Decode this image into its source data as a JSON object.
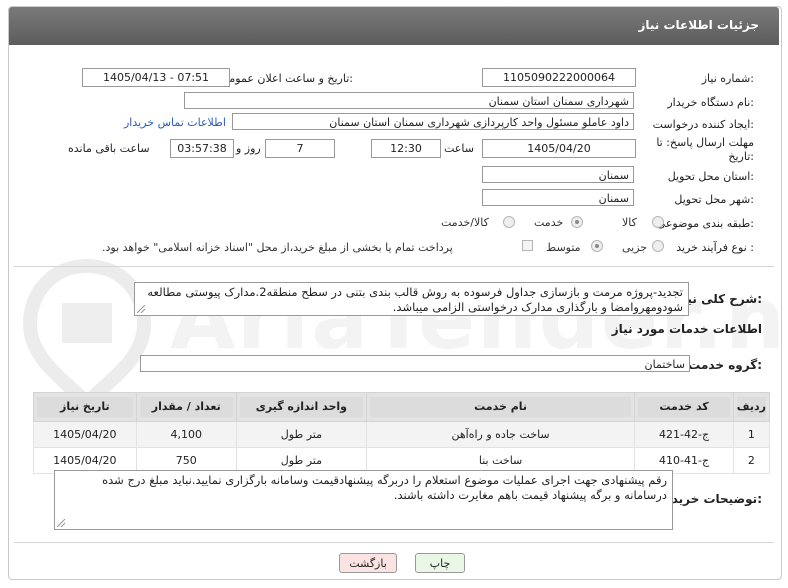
{
  "header": {
    "title": "جزئیات اطلاعات نیاز"
  },
  "watermark": {
    "text": "AriaTender.neT"
  },
  "form": {
    "need_number": {
      "label": "شماره نیاز:",
      "value": "1105090222000064"
    },
    "announce_datetime": {
      "label": "تاریخ و ساعت اعلان عمومی:",
      "value": "1405/04/13 - 07:51"
    },
    "buyer_org": {
      "label": "نام دستگاه خریدار:",
      "value": "شهرداری سمنان استان سمنان"
    },
    "requester": {
      "label": "ایجاد کننده درخواست:",
      "value": "داود عاملو مسئول واحد کارپردازی شهرداری سمنان استان سمنان",
      "contact_link": "اطلاعات تماس خریدار"
    },
    "deadline": {
      "label": "مهلت ارسال پاسخ: تا تاریخ:",
      "date": "1405/04/20",
      "time_label": "ساعت",
      "time": "12:30",
      "days": "7",
      "days_label": "روز و",
      "remaining": "03:57:38",
      "remaining_label": "ساعت باقی مانده"
    },
    "delivery_province": {
      "label": "استان محل تحویل:",
      "value": "سمنان"
    },
    "delivery_city": {
      "label": "شهر محل تحویل:",
      "value": "سمنان"
    },
    "category": {
      "label": "طبقه بندی موضوعی:",
      "options": [
        "کالا",
        "خدمت",
        "کالا/خدمت"
      ],
      "selected": "خدمت"
    },
    "purchase_type": {
      "label": "نوع فرآیند خرید :",
      "options": [
        "جزیی",
        "متوسط"
      ],
      "selected": "متوسط",
      "payment_note": "پرداخت تمام یا بخشی از مبلغ خرید،از محل \"اسناد خزانه اسلامی\" خواهد بود."
    }
  },
  "summary": {
    "label": "شرح کلی نیاز:",
    "text": "تجدید-پروژه مرمت و بازسازی جداول فرسوده به روش قالب بندی بتنی در سطح منطقه2.مدارک پیوستی مطالعه شودومهروامضا و بارگذاری مدارک درخواستی الزامی میباشد."
  },
  "services": {
    "section_title": "اطلاعات خدمات مورد نیاز",
    "group_label": "گروه خدمت:",
    "group_value": "ساختمان",
    "columns": [
      "ردیف",
      "کد خدمت",
      "نام خدمت",
      "واحد اندازه گیری",
      "تعداد / مقدار",
      "تاریخ نیاز"
    ],
    "rows": [
      {
        "idx": "1",
        "code": "ج-42-421",
        "name": "ساخت جاده و راه‌آهن",
        "unit": "متر طول",
        "qty": "4,100",
        "date": "1405/04/20"
      },
      {
        "idx": "2",
        "code": "ج-41-410",
        "name": "ساخت بنا",
        "unit": "متر طول",
        "qty": "750",
        "date": "1405/04/20"
      }
    ]
  },
  "buyer_notes": {
    "label": "توضیحات خریدار:",
    "text": "رقم پیشنهادی جهت اجرای عملیات موضوع استعلام را دربرگه پیشنهادقیمت وسامانه بارگزاری نمایید.نباید مبلغ درج شده درسامانه و برگه پیشنهاد قیمت باهم مغایرت داشته باشند."
  },
  "buttons": {
    "print": "چاپ",
    "back": "بازگشت"
  }
}
